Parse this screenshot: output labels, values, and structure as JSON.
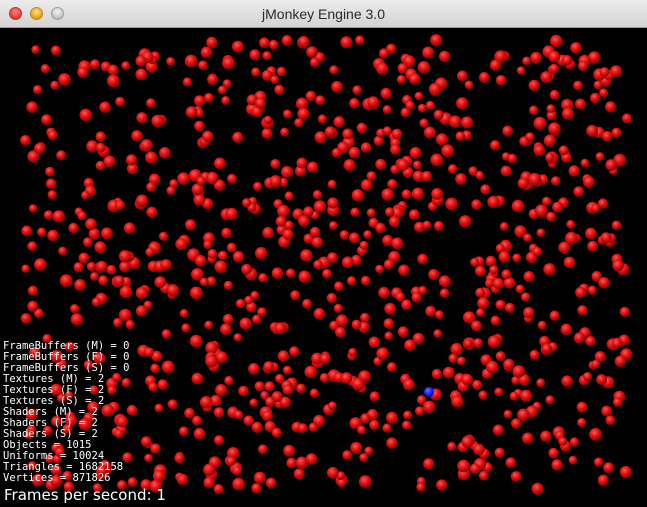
{
  "window": {
    "title": "jMonkey Engine 3.0"
  },
  "colors": {
    "background": "#000000",
    "sphere": "#e01010",
    "sphere_highlight": "#ff4a4a",
    "marker": "#1a22ff",
    "text": "#ffffff"
  },
  "stats": [
    "FrameBuffers (M) = 0",
    "FrameBuffers (F) = 0",
    "FrameBuffers (S) = 0",
    "Textures (M) = 2",
    "Textures (F) = 2",
    "Textures (S) = 2",
    "Shaders (M) = 2",
    "Shaders (F) = 2",
    "Shaders (S) = 2",
    "Objects = 1015",
    "Uniforms = 10024",
    "Triangles = 1682158",
    "Vertices = 871826"
  ],
  "fps": {
    "label": "Frames per second: 1"
  }
}
